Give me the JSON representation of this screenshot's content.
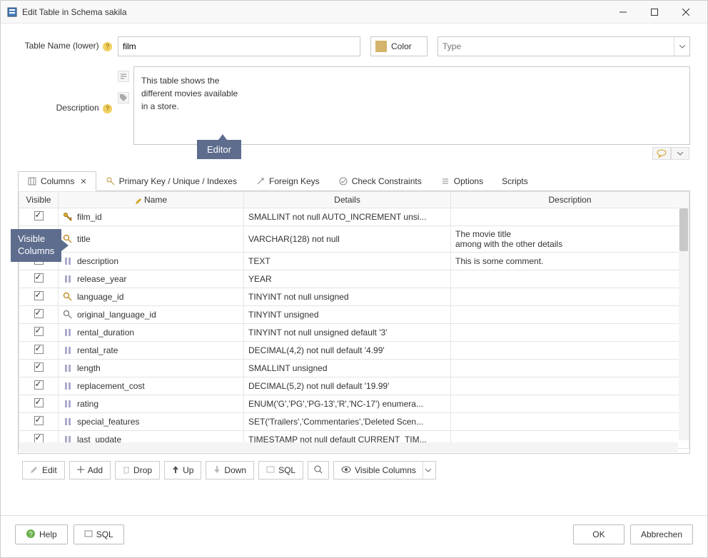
{
  "window_title": "Edit Table in Schema sakila",
  "labels": {
    "table_name": "Table Name (lower)",
    "description": "Description",
    "color": "Color",
    "type_placeholder": "Type"
  },
  "values": {
    "table_name": "film",
    "description": "This table shows the\ndifferent movies available\nin a store."
  },
  "callouts": {
    "editor": "Editor",
    "visible_columns": "Visible\nColumns"
  },
  "tabs": [
    {
      "id": "columns",
      "label": "Columns",
      "active": true,
      "closable": true
    },
    {
      "id": "pk",
      "label": "Primary Key / Unique / Indexes",
      "active": false,
      "closable": false
    },
    {
      "id": "fk",
      "label": "Foreign Keys",
      "active": false,
      "closable": false
    },
    {
      "id": "chk",
      "label": "Check Constraints",
      "active": false,
      "closable": false
    },
    {
      "id": "opts",
      "label": "Options",
      "active": false,
      "closable": false
    },
    {
      "id": "scripts",
      "label": "Scripts",
      "active": false,
      "closable": false
    }
  ],
  "grid": {
    "headers": {
      "visible": "Visible",
      "name": "Name",
      "details": "Details",
      "description": "Description"
    },
    "rows": [
      {
        "visible": true,
        "icon": "key",
        "name": "film_id",
        "details": "SMALLINT not null AUTO_INCREMENT unsi...",
        "desc": ""
      },
      {
        "visible": true,
        "icon": "idx",
        "name": "title",
        "details": "VARCHAR(128) not null",
        "desc": "The movie title\namong with the other details"
      },
      {
        "visible": true,
        "icon": "col",
        "name": "description",
        "details": "TEXT",
        "desc": "This is some comment."
      },
      {
        "visible": true,
        "icon": "col",
        "name": "release_year",
        "details": "YEAR",
        "desc": ""
      },
      {
        "visible": true,
        "icon": "idx",
        "name": "language_id",
        "details": "TINYINT not null unsigned",
        "desc": ""
      },
      {
        "visible": true,
        "icon": "lens",
        "name": "original_language_id",
        "details": "TINYINT unsigned",
        "desc": ""
      },
      {
        "visible": true,
        "icon": "col",
        "name": "rental_duration",
        "details": "TINYINT not null unsigned default '3'",
        "desc": ""
      },
      {
        "visible": true,
        "icon": "col",
        "name": "rental_rate",
        "details": "DECIMAL(4,2) not null default '4.99'",
        "desc": ""
      },
      {
        "visible": true,
        "icon": "col",
        "name": "length",
        "details": "SMALLINT unsigned",
        "desc": ""
      },
      {
        "visible": true,
        "icon": "col",
        "name": "replacement_cost",
        "details": "DECIMAL(5,2) not null default '19.99'",
        "desc": ""
      },
      {
        "visible": true,
        "icon": "col",
        "name": "rating",
        "details": "ENUM('G','PG','PG-13','R','NC-17') enumera...",
        "desc": ""
      },
      {
        "visible": true,
        "icon": "col",
        "name": "special_features",
        "details": "SET('Trailers','Commentaries','Deleted Scen...",
        "desc": ""
      },
      {
        "visible": true,
        "icon": "col",
        "name": "last_update",
        "details": "TIMESTAMP not null default CURRENT_TIM...",
        "desc": ""
      }
    ]
  },
  "toolbar": {
    "edit": "Edit",
    "add": "Add",
    "drop": "Drop",
    "up": "Up",
    "down": "Down",
    "sql": "SQL",
    "visible_columns": "Visible Columns"
  },
  "footer": {
    "help": "Help",
    "sql": "SQL",
    "ok": "OK",
    "cancel": "Abbrechen"
  }
}
